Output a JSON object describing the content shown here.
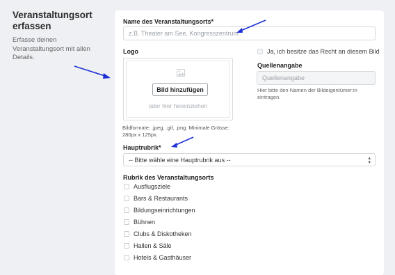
{
  "sidebar": {
    "title_line1": "Veranstaltungsort",
    "title_line2": "erfassen",
    "desc_line1": "Erfasse deinen",
    "desc_line2": "Veranstaltungsort mit allen",
    "desc_line3": "Details."
  },
  "form": {
    "name": {
      "label": "Name des Veranstaltungsorts*",
      "placeholder": "z.B. Theater am See, Kongresszentrum"
    },
    "logo": {
      "label": "Logo",
      "upload_button": "Bild hinzufügen",
      "drag_text": "oder hier hereinziehen",
      "format_hint_line1": "Bildformate: .jpeg, .gif, .png. Minimale Grösse:",
      "format_hint_line2": "280px x 125px."
    },
    "rights": {
      "checkbox_label": "Ja, ich besitze das Recht an diesem Bild"
    },
    "source": {
      "label": "Quellenangabe",
      "placeholder": "Quellenangabe",
      "hint_line1": "Hier bitte den Namen der Bildeigentümer:in",
      "hint_line2": "eintragen."
    },
    "main_category": {
      "label": "Hauptrubrik*",
      "selected": "-- Bitte wähle eine Hauptrubrik aus --"
    },
    "categories": {
      "label": "Rubrik des Veranstaltungsorts",
      "items": [
        "Ausflugsziele",
        "Bars & Restaurants",
        "Bildungseinrichtungen",
        "Bühnen",
        "Clubs & Diskotheken",
        "Hallen & Säle",
        "Hotels & Gasthäuser"
      ]
    }
  },
  "colors": {
    "annotation_arrow": "#1f2fd6",
    "background": "#eef0f3",
    "card": "#ffffff"
  },
  "icons": {
    "upload_placeholder": "image-icon",
    "select_arrows": "chevron-up-down-icon"
  }
}
